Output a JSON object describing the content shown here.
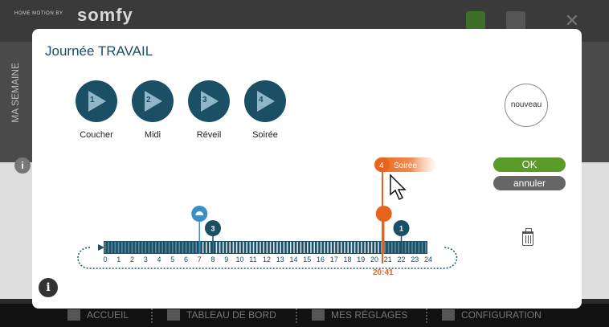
{
  "background": {
    "brand_prefix": "HOME MOTION BY",
    "brand_logo": "somfy",
    "side_label": "MA SEMAINE",
    "bottom_nav": [
      {
        "label": "ACCUEIL",
        "icon": "home-icon"
      },
      {
        "label": "TABLEAU DE BORD",
        "icon": "dashboard-icon"
      },
      {
        "label": "MES RÉGLAGES",
        "icon": "user-icon"
      },
      {
        "label": "CONFIGURATION",
        "icon": "gear-icon"
      }
    ]
  },
  "modal": {
    "title": "Journée TRAVAIL",
    "modes": [
      {
        "number": "1",
        "label": "Coucher"
      },
      {
        "number": "2",
        "label": "Midi"
      },
      {
        "number": "3",
        "label": "Réveil"
      },
      {
        "number": "4",
        "label": "Soirée"
      }
    ],
    "new_button": "nouveau",
    "ok_button": "OK",
    "cancel_button": "annuler",
    "timeline": {
      "hours": [
        "0",
        "1",
        "2",
        "3",
        "4",
        "5",
        "6",
        "7",
        "8",
        "9",
        "10",
        "11",
        "12",
        "13",
        "14",
        "15",
        "16",
        "17",
        "18",
        "19",
        "20",
        "21",
        "22",
        "23",
        "24"
      ],
      "current_time": "20:41",
      "active_tag": {
        "number": "4",
        "label": "Soirée"
      },
      "markers": [
        {
          "type": "sunrise",
          "hour": 7,
          "color": "#3a8fc4"
        },
        {
          "type": "mode",
          "number": "3",
          "hour": 8,
          "color": "#1b4f66"
        },
        {
          "type": "moon",
          "hour": 20.7,
          "color": "#e8641e"
        },
        {
          "type": "mode",
          "number": "1",
          "hour": 22,
          "color": "#1b4f66"
        }
      ]
    }
  },
  "colors": {
    "accent": "#1b4f66",
    "orange": "#e8641e",
    "ok": "#5a9b2a",
    "cancel": "#666666"
  }
}
